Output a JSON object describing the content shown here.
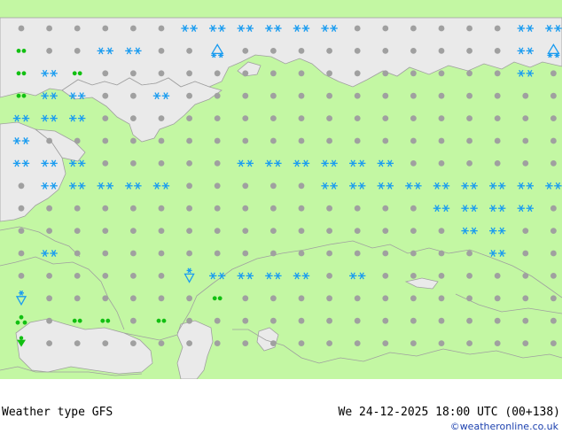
{
  "footer": {
    "title": "Weather type  GFS",
    "valid": "We 24-12-2025 18:00 UTC (00+138)",
    "credit": "©weatheronline.co.uk"
  },
  "colors": {
    "land": "#c3f7a3",
    "sea": "#eaeaea",
    "border": "#a0a0a0",
    "dry": "#a0a0a0",
    "snow": "#1a9cf0",
    "rain": "#12c012"
  },
  "grid": {
    "rows": [
      "ddddddSSSSSSddddddSSSdSd",
      "rddSSddAddddddddddSAShdA",
      "rSrdddddddddddddddSddddd",
      "rSSddSdddddddddddddddddd",
      "SSSddddddddddddddddddddd",
      "Sdddddddddddddddddddddd",
      "SSSdddddSSSSSSdddddddddd",
      "dSSSSSdddddSSSSSSSSSdddd",
      "dddddddddddddddSSSSddddd",
      "ddddddddddddddddSSdddAdd",
      "dSdddddddddddddddSdddddd",
      "ddddddhSSSSdSddddddddddd",
      "hddddddrdddddddddddddddd",
      "tdrrdrdddddddddddddddddd",
      "Rddddddddddddddddddddddd"
    ]
  }
}
